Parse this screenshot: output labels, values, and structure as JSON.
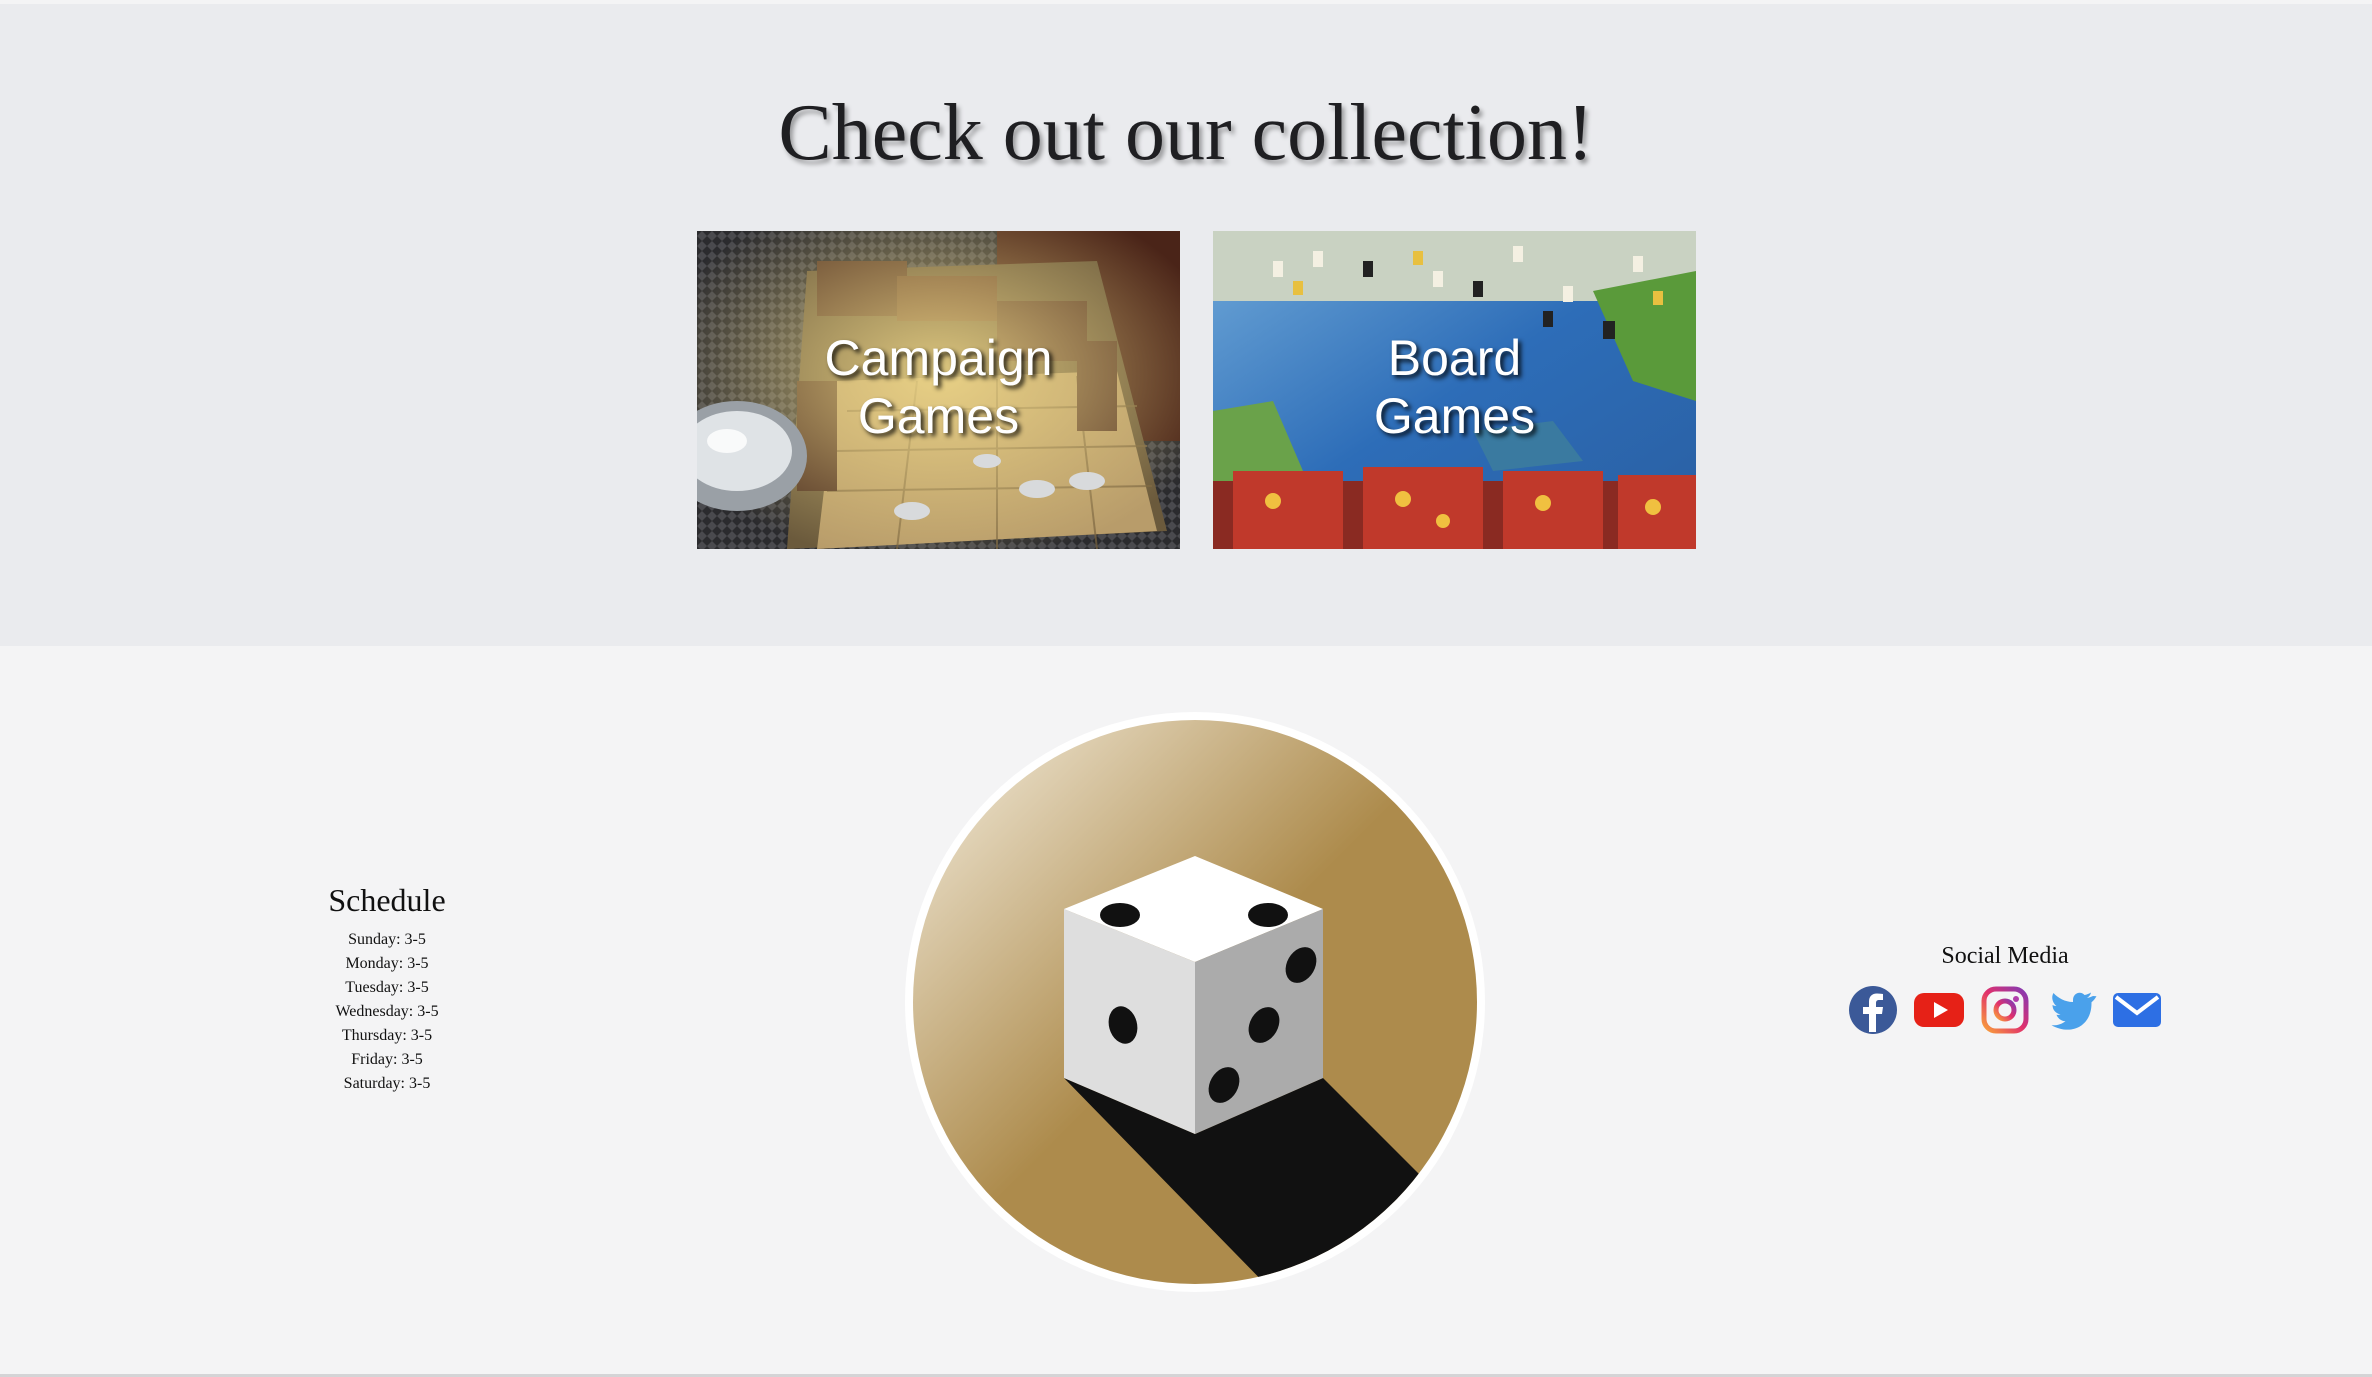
{
  "collection": {
    "heading": "Check out our collection!",
    "cards": [
      {
        "line1": "Campaign",
        "line2": "Games"
      },
      {
        "line1": "Board",
        "line2": "Games"
      }
    ]
  },
  "schedule": {
    "title": "Schedule",
    "days": [
      "Sunday: 3-5",
      "Monday: 3-5",
      "Tuesday: 3-5",
      "Wednesday: 3-5",
      "Thursday: 3-5",
      "Friday: 3-5",
      "Saturday: 3-5"
    ]
  },
  "social": {
    "title": "Social Media",
    "icons": [
      "facebook-icon",
      "youtube-icon",
      "instagram-icon",
      "twitter-icon",
      "email-icon"
    ]
  },
  "colors": {
    "collection_bg": "#eaebee",
    "footer_bg": "#f4f4f5",
    "logo_gold": "#ad8b4c",
    "facebook": "#3b5998",
    "youtube": "#e62117",
    "twitter": "#4aa1eb",
    "email": "#2d6fe4"
  }
}
